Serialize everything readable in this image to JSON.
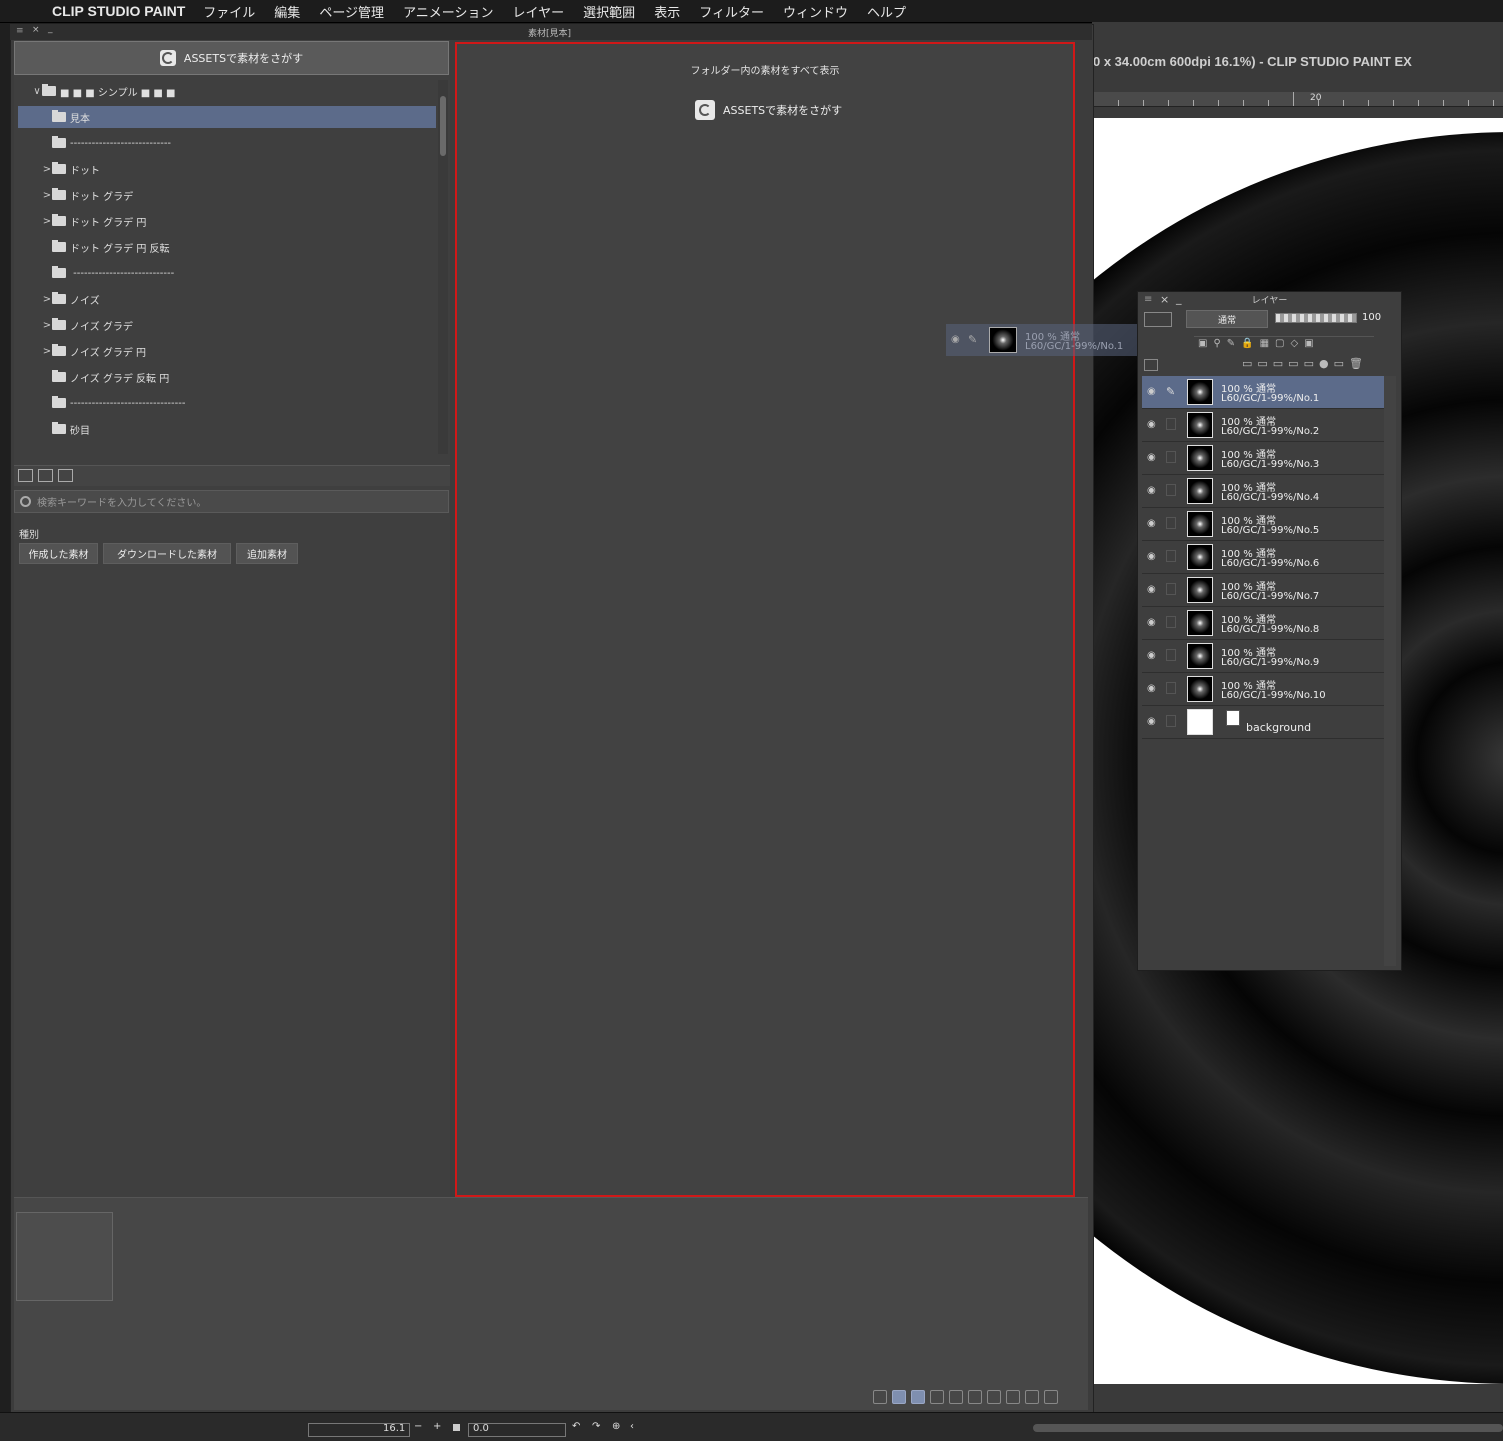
{
  "menubar": {
    "apple": "",
    "app_name": "CLIP STUDIO PAINT",
    "items": [
      "ファイル",
      "編集",
      "ページ管理",
      "アニメーション",
      "レイヤー",
      "選択範囲",
      "表示",
      "フィルター",
      "ウィンドウ",
      "ヘルプ"
    ]
  },
  "canvas": {
    "title": "0 x 34.00cm 600dpi 16.1%)  - CLIP STUDIO PAINT EX",
    "ruler_label": "20"
  },
  "material": {
    "window_title": "素材[見本]",
    "assets_button": "ASSETSで素材をさがす",
    "tree": [
      {
        "label": "■ ■ ■ シンプル ■ ■ ■",
        "chevron": "∨",
        "selected": false
      },
      {
        "label": "見本",
        "chevron": "",
        "selected": true
      },
      {
        "label": "----------------------------",
        "chevron": "",
        "selected": false
      },
      {
        "label": "ドット",
        "chevron": ">",
        "selected": false
      },
      {
        "label": "ドット グラデ",
        "chevron": ">",
        "selected": false
      },
      {
        "label": "ドット グラデ 円",
        "chevron": ">",
        "selected": false
      },
      {
        "label": "ドット グラデ 円 反転",
        "chevron": "",
        "selected": false
      },
      {
        "label": " ----------------------------",
        "chevron": "",
        "selected": false
      },
      {
        "label": "ノイズ",
        "chevron": ">",
        "selected": false
      },
      {
        "label": "ノイズ グラデ",
        "chevron": ">",
        "selected": false
      },
      {
        "label": "ノイズ グラデ 円",
        "chevron": ">",
        "selected": false
      },
      {
        "label": "ノイズ グラデ 反転 円",
        "chevron": "",
        "selected": false
      },
      {
        "label": "--------------------------------",
        "chevron": "",
        "selected": false
      },
      {
        "label": "砂目",
        "chevron": "",
        "selected": false
      }
    ],
    "search_placeholder": "検索キーワードを入力してください。",
    "kind_label": "種別",
    "kind_buttons": [
      "作成した素材",
      "ダウンロードした素材",
      "追加素材"
    ],
    "show_all": "フォルダー内の素材をすべて表示",
    "assets_button_right": "ASSETSで素材をさがす"
  },
  "status": {
    "zoom": "16.1",
    "angle": "0.0"
  },
  "drag_ghost": {
    "line1": "100 % 通常",
    "line2": "L60/GC/1-99%/No.1"
  },
  "layer_panel": {
    "title": "レイヤー",
    "blend_mode": "通常",
    "opacity": "100",
    "layers": [
      {
        "l1": "100 % 通常",
        "l2": "L60/GC/1-99%/No.1",
        "selected": true
      },
      {
        "l1": "100 % 通常",
        "l2": "L60/GC/1-99%/No.2",
        "selected": false
      },
      {
        "l1": "100 % 通常",
        "l2": "L60/GC/1-99%/No.3",
        "selected": false
      },
      {
        "l1": "100 % 通常",
        "l2": "L60/GC/1-99%/No.4",
        "selected": false
      },
      {
        "l1": "100 % 通常",
        "l2": "L60/GC/1-99%/No.5",
        "selected": false
      },
      {
        "l1": "100 % 通常",
        "l2": "L60/GC/1-99%/No.6",
        "selected": false
      },
      {
        "l1": "100 % 通常",
        "l2": "L60/GC/1-99%/No.7",
        "selected": false
      },
      {
        "l1": "100 % 通常",
        "l2": "L60/GC/1-99%/No.8",
        "selected": false
      },
      {
        "l1": "100 % 通常",
        "l2": "L60/GC/1-99%/No.9",
        "selected": false
      },
      {
        "l1": "100 % 通常",
        "l2": "L60/GC/1-99%/No.10",
        "selected": false
      }
    ],
    "background_layer": "background"
  }
}
